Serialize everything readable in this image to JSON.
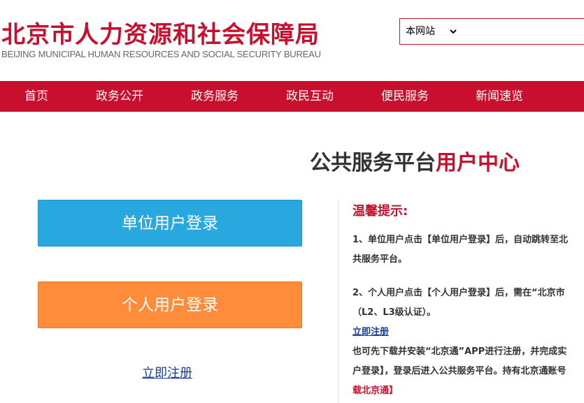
{
  "header": {
    "logo_cn": "北京市人力资源和社会保障局",
    "logo_en": "BEIJING MUNICIPAL HUMAN RESOURCES AND SOCIAL SECURITY BUREAU"
  },
  "search": {
    "scope_selected": "本网站",
    "query": ""
  },
  "nav": {
    "items": [
      "首页",
      "政务公开",
      "政务服务",
      "政民互动",
      "便民服务",
      "新闻速览"
    ]
  },
  "main": {
    "title_part1": "公共服务平台",
    "title_part2": "用户中心",
    "unit_login": "单位用户登录",
    "person_login": "个人用户登录",
    "register": "立即注册"
  },
  "tips": {
    "title": "温馨提示:",
    "line1": "1、单位用户点击【单位用户登录】后，自动跳转至北",
    "line2": "共服务平台。",
    "line3": "2、个人用户点击【个人用户登录】后，需在“北京市",
    "line4": "（L2、L3级认证）。",
    "register_link": "立即注册",
    "line5": "也可先下载并安装“北京通”APP进行注册，并完成实",
    "line6": "户登录】，登录后进入公共服务平台。持有北京通账号",
    "line7": "载北京通】"
  },
  "colors": {
    "brand_red": "#c8102e",
    "unit_blue": "#29a8df",
    "person_orange": "#ff8c3a",
    "link_blue": "#1a3d9e"
  }
}
